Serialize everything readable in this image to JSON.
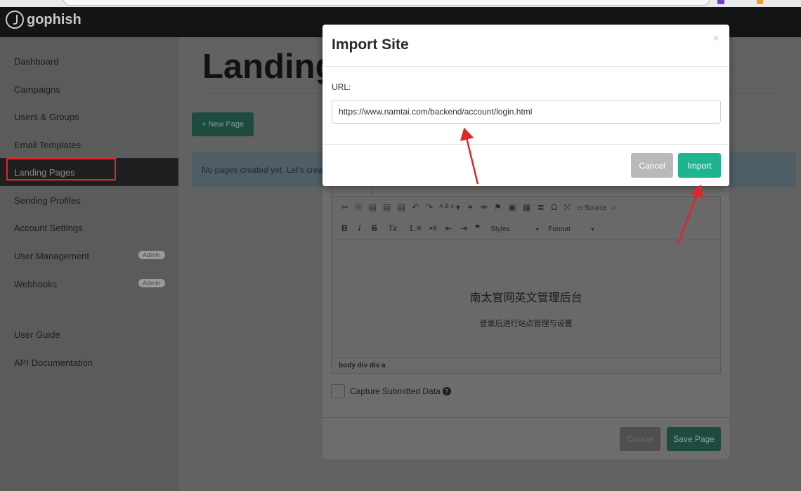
{
  "app": {
    "brand": "gophish"
  },
  "sidebar": {
    "items": [
      {
        "label": "Dashboard"
      },
      {
        "label": "Campaigns"
      },
      {
        "label": "Users & Groups"
      },
      {
        "label": "Email Templates"
      },
      {
        "label": "Landing Pages",
        "active": true
      },
      {
        "label": "Sending Profiles"
      },
      {
        "label": "Account Settings"
      },
      {
        "label": "User Management",
        "badge": "Admin"
      },
      {
        "label": "Webhooks",
        "badge": "Admin"
      },
      {
        "label": "User Guide"
      },
      {
        "label": "API Documentation"
      }
    ]
  },
  "main": {
    "title": "Landing Pages",
    "new_page_button": "+ New Page",
    "empty_message": "No pages created yet. Let's create one!"
  },
  "page_modal": {
    "editor": {
      "toolbar_source": "Source",
      "toolbar_styles": "Styles",
      "toolbar_format": "Format",
      "heading": "南太官网英文管理后台",
      "subheading": "登录后进行站点管理与设置",
      "path": "body  div  div  a"
    },
    "capture_label": "Capture Submitted Data",
    "cancel_label": "Cancel",
    "save_label": "Save Page"
  },
  "import_modal": {
    "title": "Import Site",
    "close": "×",
    "url_label": "URL:",
    "url_value": "https://www.namtai.com/backend/account/login.html",
    "cancel_label": "Cancel",
    "import_label": "Import"
  },
  "colors": {
    "accent": "#1fb48f",
    "annotation": "#e0262b",
    "navbar": "#121416"
  }
}
